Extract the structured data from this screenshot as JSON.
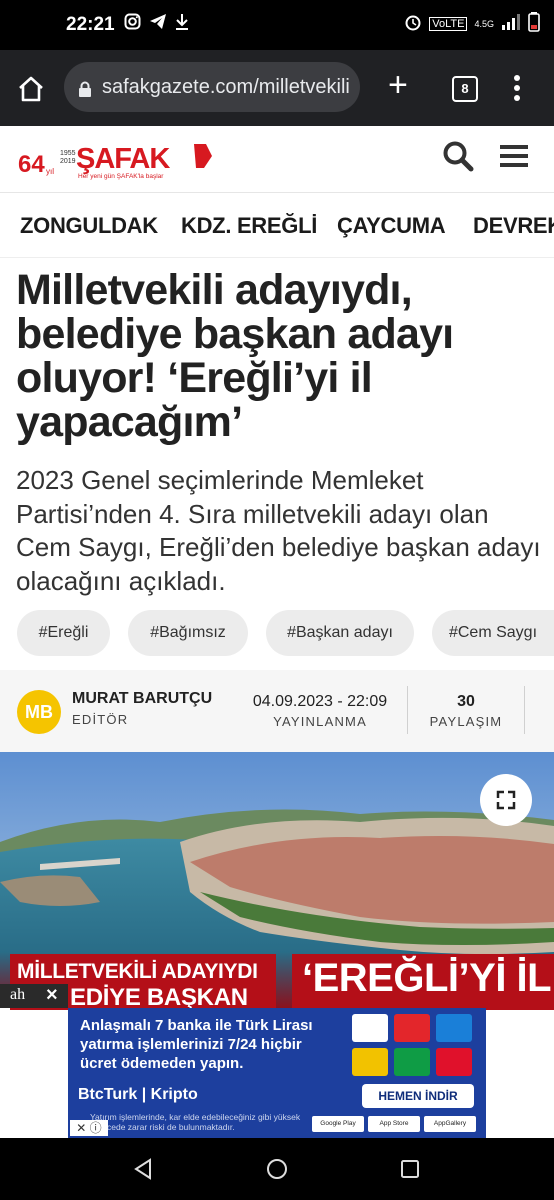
{
  "status_bar": {
    "time": "22:21",
    "network": "4.5G",
    "volte": "VoLTE"
  },
  "browser": {
    "url": "safakgazete.com/milletvekili",
    "tab_count": "8"
  },
  "site": {
    "logo_main": "ŞAFAK",
    "logo_badge": "64",
    "logo_badge_sub": "yıl",
    "logo_years": "1955 2019",
    "logo_tagline": "Her yeni gün ŞAFAK'la başlar"
  },
  "nav": {
    "items": [
      "ZONGULDAK",
      "KDZ. EREĞLİ",
      "ÇAYCUMA",
      "DEVREK"
    ]
  },
  "article": {
    "title": "Milletvekili adayıydı, belediye başkan adayı oluyor! ‘Ereğli’yi il yapacağım’",
    "summary": "2023 Genel seçimlerinde Memleket Partisi’nden 4. Sıra milletvekili adayı olan Cem Saygı, Ereğli’den belediye başkan adayı olacağını açıkladı.",
    "tags": [
      "#Ereğli",
      "#Bağımsız",
      "#Başkan adayı",
      "#Cem Saygı"
    ],
    "author_initials": "MB",
    "author": "MURAT BARUTÇU",
    "author_role": "EDİTÖR",
    "date": "04.09.2023 - 22:09",
    "date_label": "YAYINLANMA",
    "shares": "30",
    "shares_label": "PAYLAŞIM",
    "image_overlay_left_line1": "MİLLETVEKİLİ ADAYIYDI",
    "image_overlay_left_line2": "EDİYE BAŞKAN",
    "image_overlay_right": "‘EREĞLİ’Yİ İL"
  },
  "ad": {
    "close_label": "×",
    "line1": "Anlaşmalı 7 banka ile Türk Lirası yatırma işlemlerinizi 7/24 hiçbir ücret ödemeden yapın.",
    "brand": "BtcTurk | Kripto",
    "cta": "HEMEN İNDİR",
    "disclaimer": "Yatırım işlemlerinde, kar elde edebileceğiniz gibi yüksek derecede zarar riski de bulunmaktadır.",
    "stores": [
      "Google Play",
      "App Store",
      "AppGallery"
    ]
  },
  "icons": [
    "home-icon",
    "lock-icon",
    "plus-icon",
    "tabs-icon",
    "more-icon",
    "search-icon",
    "menu-icon",
    "fullscreen-icon",
    "back-icon",
    "home-nav-icon",
    "recents-icon"
  ]
}
